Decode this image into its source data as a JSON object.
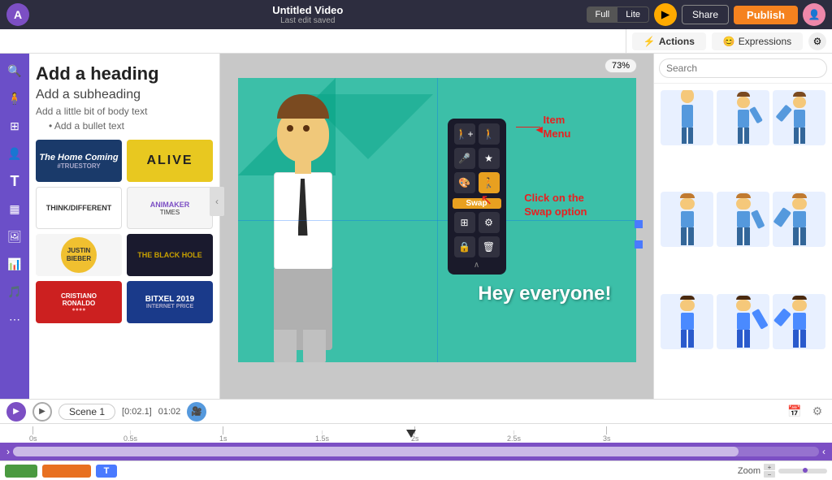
{
  "topbar": {
    "logo_text": "A",
    "title": "Untitled Video",
    "subtitle": "Last edit saved",
    "view_full": "Full",
    "view_lite": "Lite",
    "share_label": "Share",
    "publish_label": "Publish"
  },
  "toolbar2": {
    "actions_label": "Actions",
    "expressions_label": "Expressions",
    "actions_icon": "⚡",
    "expressions_icon": "😊"
  },
  "left_panel": {
    "heading": "Add a heading",
    "subheading": "Add a subheading",
    "body_text": "Add a little bit of body text",
    "bullet": "Add a bullet text",
    "media_items": [
      {
        "label": "The Home Coming",
        "sub": "#TRUESTORY"
      },
      {
        "label": "ALIVE",
        "type": "yellow-text"
      },
      {
        "label": "THINK/DIFFERENT",
        "type": "small"
      },
      {
        "label": "ANIMAKER TIMES",
        "type": "small-light"
      },
      {
        "label": "JUSTIN BIEBER",
        "type": "circle-yellow"
      },
      {
        "label": "THE BLACK HOLE",
        "type": "dark"
      },
      {
        "label": "CRISTIANO RONALDO",
        "type": "red"
      },
      {
        "label": "BITXEL 2019",
        "type": "blue"
      }
    ]
  },
  "canvas": {
    "zoom": "73%",
    "canvas_text": "Hey everyone!",
    "item_menu_items": [
      "person-add",
      "person",
      "mic",
      "star",
      "palette",
      "person2",
      "grid",
      "gear",
      "lock",
      "trash"
    ],
    "swap_label": "Swap",
    "annotation_item_menu": "Item\nMenu",
    "annotation_swap": "Click on the\nSwap option"
  },
  "right_panel": {
    "search_placeholder": "Search",
    "characters": [
      "char1",
      "char2",
      "char3",
      "char4",
      "char5",
      "char6",
      "char7",
      "char8",
      "char9"
    ]
  },
  "timeline": {
    "play_label": "▶",
    "scene_label": "Scene 1",
    "time_start": "[0:02.1]",
    "time_end": "01:02",
    "ruler_marks": [
      "0s",
      "0.5s",
      "1s",
      "1.5s",
      "2s",
      "2.5s",
      "3s"
    ],
    "zoom_label": "Zoom"
  }
}
